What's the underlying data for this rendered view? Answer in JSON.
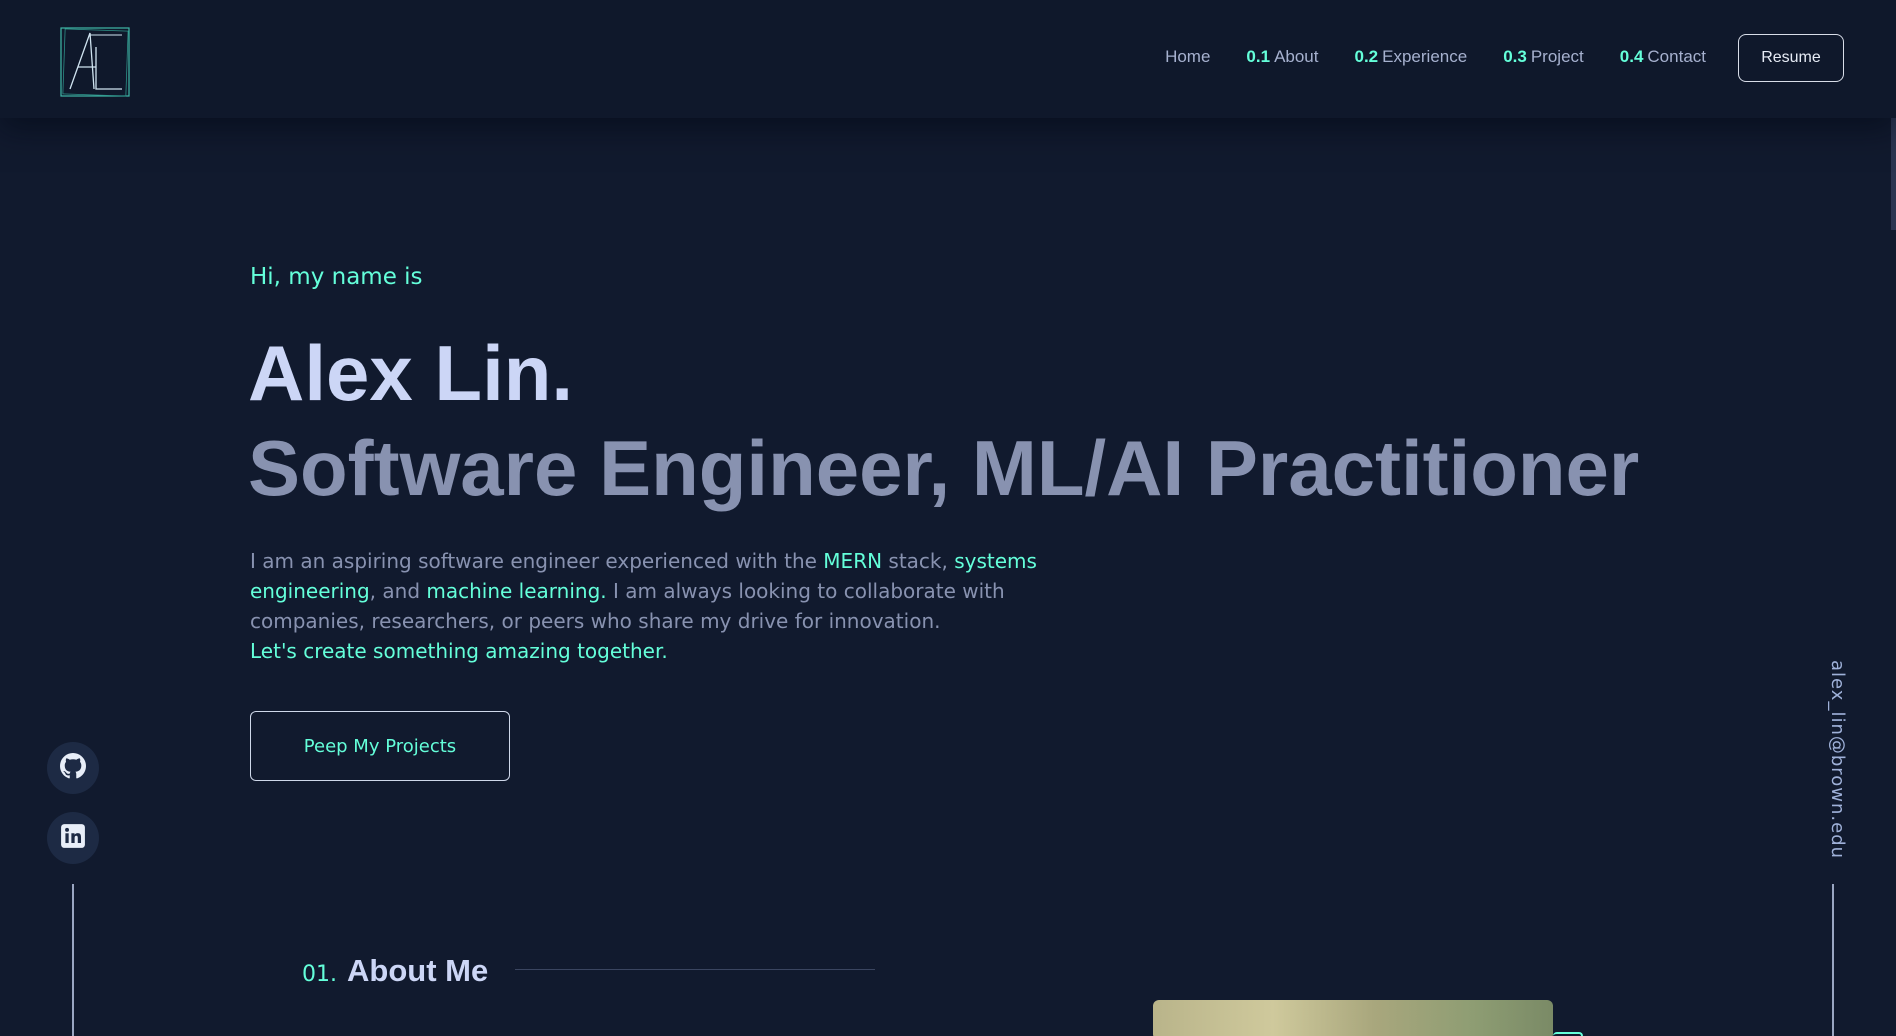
{
  "nav": {
    "logo_alt": "AL",
    "links": [
      {
        "num": "",
        "label": "Home"
      },
      {
        "num": "0.1",
        "label": "About"
      },
      {
        "num": "0.2",
        "label": "Experience"
      },
      {
        "num": "0.3",
        "label": "Project"
      },
      {
        "num": "0.4",
        "label": "Contact"
      }
    ],
    "resume_label": "Resume"
  },
  "hero": {
    "greeting": "Hi, my name is",
    "name": "Alex Lin.",
    "title": "Software Engineer, ML/AI Practitioner",
    "bio": {
      "p1": "I am an aspiring software engineer experienced with the ",
      "hl1": "MERN",
      "p2": " stack, ",
      "hl2": "systems engineering",
      "p3": ", and ",
      "hl3": "machine learning.",
      "p4": " I am always looking to collaborate with companies, researchers, or peers who share my drive for innovation.",
      "cta": "Let's create something amazing together."
    },
    "button_label": "Peep My Projects"
  },
  "socials": {
    "github_icon": "github-icon",
    "linkedin_icon": "linkedin-icon"
  },
  "email": "alex_lin@brown.edu",
  "about": {
    "num": "01.",
    "title": "About Me"
  },
  "colors": {
    "background": "#111a2e",
    "accent": "#64ffda",
    "heading": "#ccd6f6",
    "muted": "#8892b0"
  }
}
